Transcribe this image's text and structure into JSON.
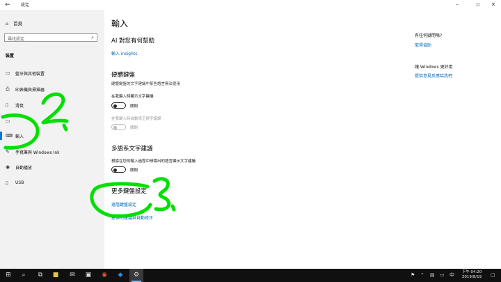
{
  "window": {
    "title": "設定"
  },
  "sidebar": {
    "home_label": "首頁",
    "search_placeholder": "尋找設定",
    "section_label": "裝置",
    "items": [
      {
        "label": "藍牙與其他裝置",
        "icon": "bluetooth-devices-icon"
      },
      {
        "label": "印表機與掃描器",
        "icon": "printer-icon"
      },
      {
        "label": "滑鼠",
        "icon": "mouse-icon"
      },
      {
        "label": "",
        "icon": "touchpad-icon"
      },
      {
        "label": "輸入",
        "icon": "keyboard-icon"
      },
      {
        "label": "手寫筆與 Windows Ink",
        "icon": "pen-icon"
      },
      {
        "label": "自動播放",
        "icon": "autoplay-icon"
      },
      {
        "label": "USB",
        "icon": "usb-icon"
      }
    ]
  },
  "main": {
    "title": "輸入",
    "ai_heading": "AI 對您有何幫助",
    "ai_link": "輸入 insights",
    "hw_heading": "硬體鍵盤",
    "hw_desc": "硬體鍵盤的文字建議中某些語言無法使用",
    "hw_suggest_label": "在我鍵入時顯示文字建議",
    "hw_suggest_state": "關閉",
    "hw_autocorrect_label": "在我鍵入時自動修正拼字錯誤",
    "hw_autocorrect_state": "關閉",
    "ml_heading": "多語系文字建議",
    "ml_label": "根據在您的輸入過程中辨識出的語言顯示文字建議",
    "ml_state": "關閉",
    "more_heading": "更多鍵盤設定",
    "more_link1": "進階鍵盤設定",
    "more_link2": "提供的建議與自動修正"
  },
  "side_panel": {
    "help_heading": "有任何疑問嗎?",
    "help_link": "取得協助",
    "improve_heading": "讓 Windows 更好用",
    "improve_link": "提供意見反應給我們"
  },
  "annotations": {
    "mark2": "2.",
    "mark3": "3."
  },
  "taskbar": {
    "time": "下午 04:20",
    "date": "2019/8/19",
    "ime": "中"
  },
  "colors": {
    "accent": "#0078d7",
    "link": "#0067b8",
    "annotation": "#00e000"
  }
}
